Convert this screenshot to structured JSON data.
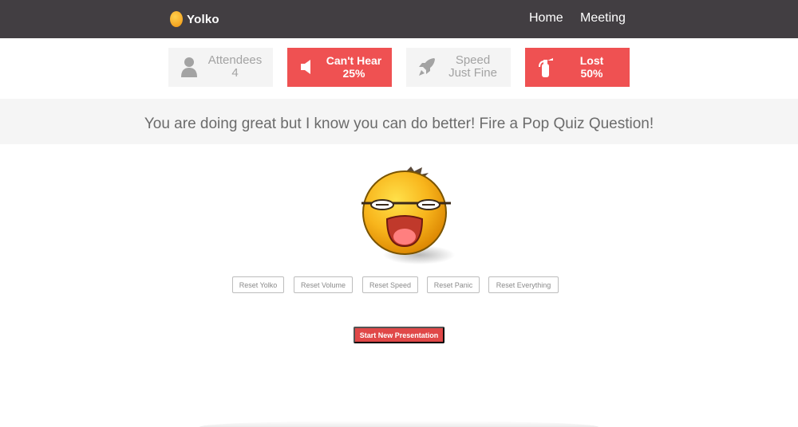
{
  "header": {
    "brand": "Yolko",
    "nav": [
      "Home",
      "Meeting"
    ]
  },
  "stats": [
    {
      "icon": "person-icon",
      "title": "Attendees",
      "value": "4",
      "style": "gray"
    },
    {
      "icon": "speaker-icon",
      "title": "Can't Hear",
      "value": "25%",
      "style": "red"
    },
    {
      "icon": "rocket-icon",
      "title": "Speed",
      "value": "Just Fine",
      "style": "gray"
    },
    {
      "icon": "fire-extinguisher-icon",
      "title": "Lost",
      "value": "50%",
      "style": "red"
    }
  ],
  "banner": "You are doing great but I know you can do better! Fire a Pop Quiz Question!",
  "resets": [
    "Reset Yolko",
    "Reset Volume",
    "Reset Speed",
    "Reset Panic",
    "Reset Everything"
  ],
  "start_button": "Start New Presentation",
  "colors": {
    "topbar": "#423e42",
    "accent_red": "#ef5152",
    "tile_gray": "#f4f4f4",
    "brand_yellow": "#f5a623"
  }
}
